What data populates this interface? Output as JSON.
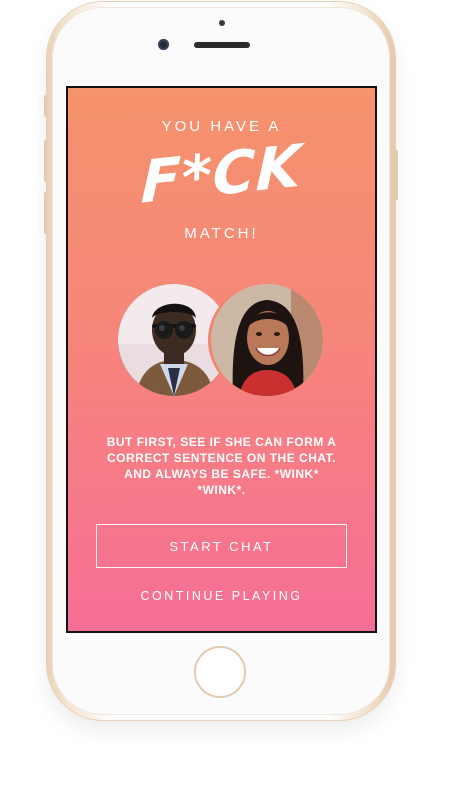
{
  "match_screen": {
    "headline_top": "YOU HAVE A",
    "headline_main": "F*CK",
    "headline_bottom": "MATCH!",
    "message": "BUT FIRST, SEE IF SHE CAN FORM A CORRECT SENTENCE ON THE CHAT. AND ALWAYS BE SAFE. *WINK* *WINK*.",
    "start_chat_label": "START CHAT",
    "continue_label": "CONTINUE PLAYING"
  },
  "colors": {
    "gradient_top": "#f5936c",
    "gradient_bottom": "#f66e96",
    "text": "#ffffff",
    "phone_frame": "#e9d3b9"
  },
  "avatars": [
    {
      "name": "avatar-man",
      "icon": "user-photo-man-sunglasses"
    },
    {
      "name": "avatar-woman",
      "icon": "user-photo-woman-smiling"
    }
  ]
}
